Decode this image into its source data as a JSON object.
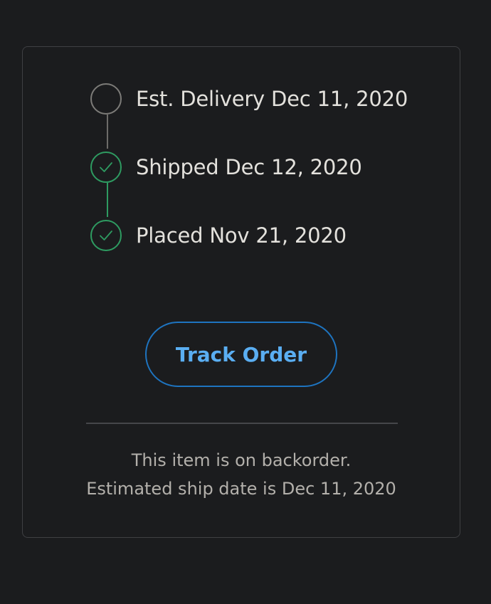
{
  "order_status": {
    "steps": [
      {
        "label": "Est. Delivery Dec 11, 2020",
        "state": "pending",
        "icon": "empty-circle-icon"
      },
      {
        "label": "Shipped Dec 12, 2020",
        "state": "done",
        "icon": "check-circle-icon"
      },
      {
        "label": "Placed Nov 21, 2020",
        "state": "done",
        "icon": "check-circle-icon"
      }
    ],
    "track_button_label": "Track Order",
    "backorder_line1": "This item is on backorder.",
    "backorder_line2": "Estimated ship date is Dec 11, 2020"
  },
  "colors": {
    "background": "#1b1c1e",
    "card_border": "#3f4043",
    "pending": "#7c7b78",
    "success": "#2e9b61",
    "accent": "#5aaef2",
    "accent_border": "#1e74c0"
  }
}
